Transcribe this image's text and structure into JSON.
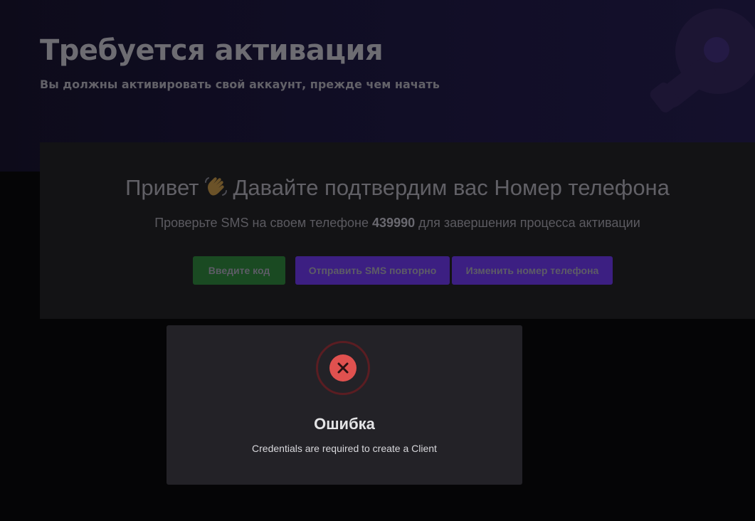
{
  "header": {
    "title": "Требуется активация",
    "subtitle": "Вы должны активировать свой аккаунт, прежде чем начать"
  },
  "card": {
    "title_before": "Привет",
    "title_after": "Давайте подтвердим вас Номер телефона",
    "text_before": "Проверьте SMS на своем телефоне",
    "phone": "439990",
    "text_after": "для завершения процесса активации",
    "buttons": {
      "enter_code": "Введите код",
      "resend_sms": "Отправить SMS повторно",
      "change_phone": "Изменить номер телефона"
    }
  },
  "modal": {
    "icon": "error-x-icon",
    "title": "Ошибка",
    "message": "Credentials are required to create a Client"
  },
  "colors": {
    "enter_code_button": "#1a4a22",
    "sms_buttons": "#3c1f82",
    "error_icon": "#e0514f",
    "modal_background": "#232227"
  }
}
